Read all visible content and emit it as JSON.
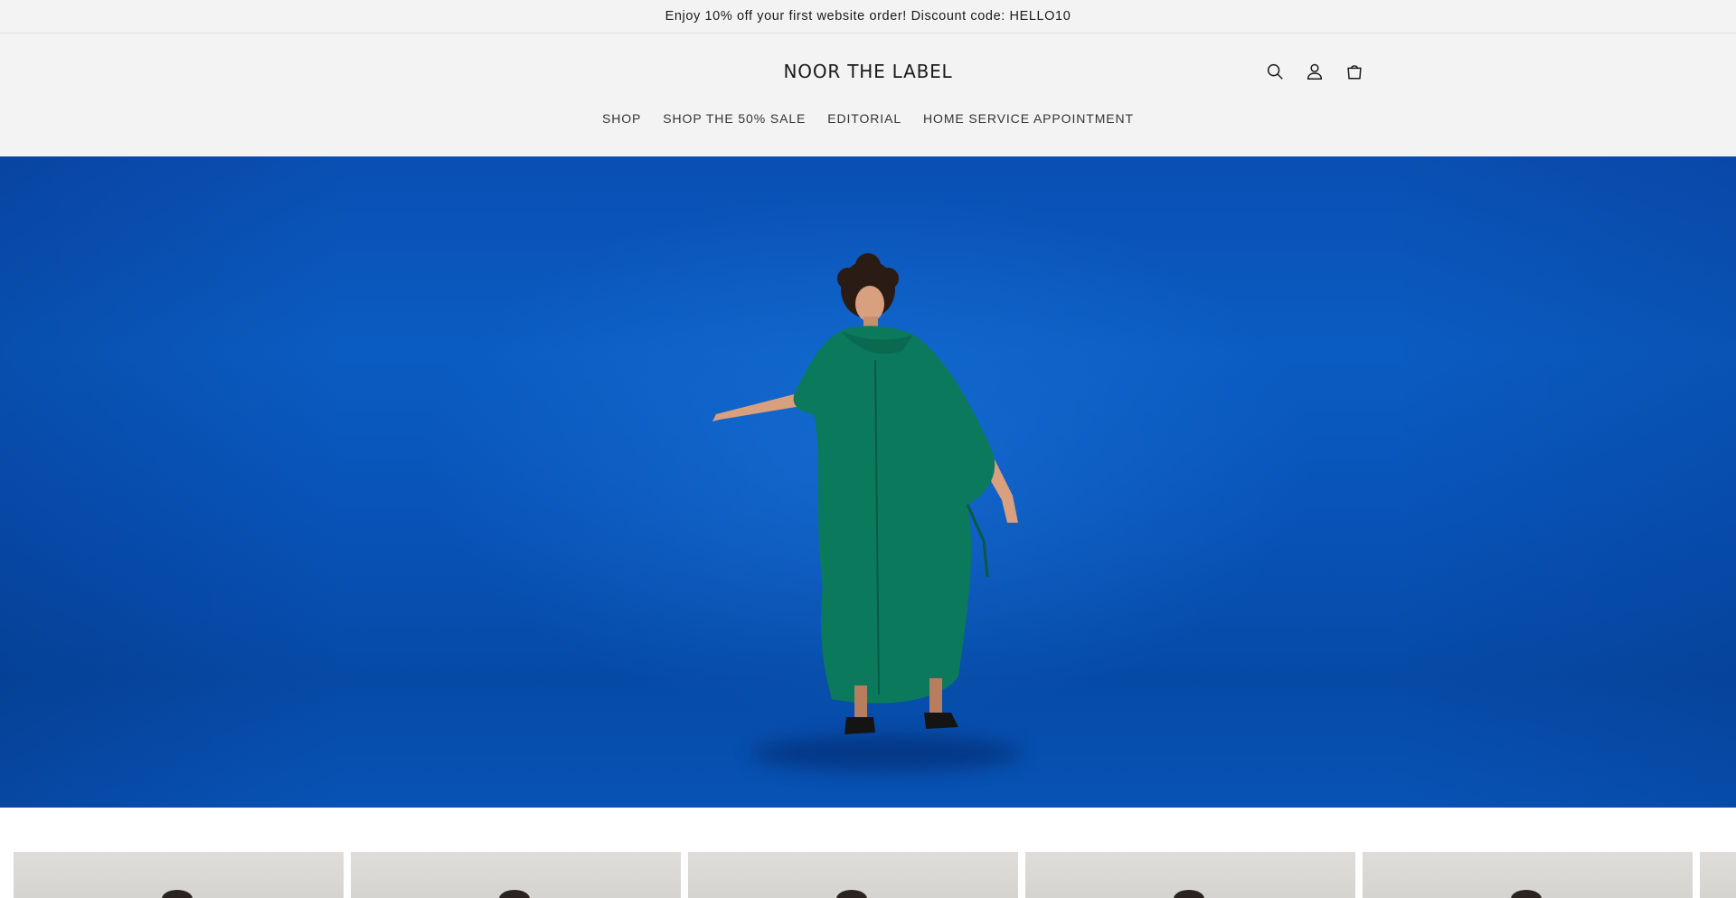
{
  "announcement": {
    "text": "Enjoy 10% off your first website order! Discount code: HELLO10"
  },
  "header": {
    "logo": "NOOR THE LABEL",
    "icons": [
      "search-icon",
      "account-icon",
      "cart-icon"
    ]
  },
  "nav": {
    "items": [
      {
        "label": "SHOP"
      },
      {
        "label": "SHOP THE 50% SALE"
      },
      {
        "label": "EDITORIAL"
      },
      {
        "label": "HOME SERVICE APPOINTMENT"
      }
    ]
  },
  "colors": {
    "header_bg": "#f3f3f3",
    "hero_blue": "#0a5cc2",
    "dress_green": "#0b7a5c"
  }
}
